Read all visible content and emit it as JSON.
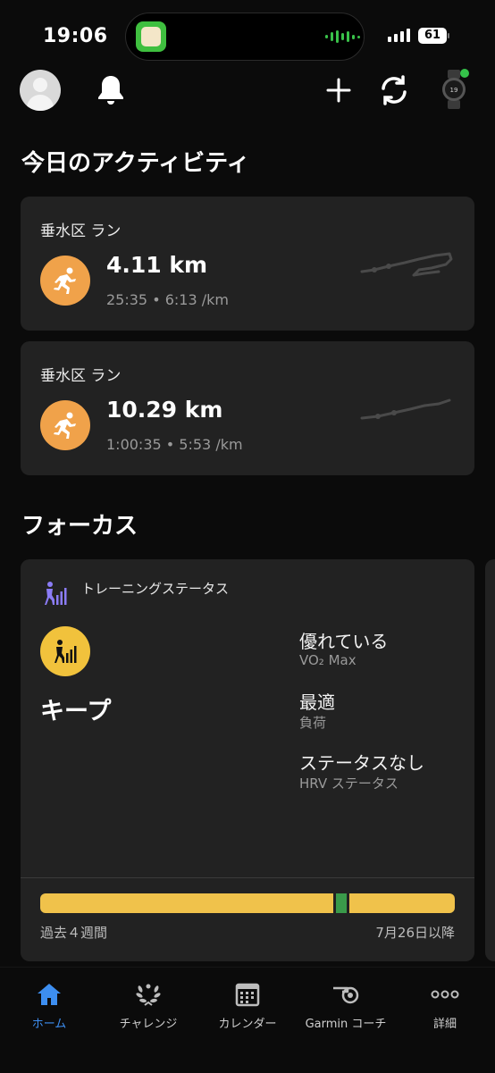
{
  "status_bar": {
    "time": "19:06",
    "battery": "61"
  },
  "today": {
    "title": "今日のアクティビティ",
    "activities": [
      {
        "name": "垂水区 ラン",
        "distance": "4.11 km",
        "duration": "25:35",
        "pace": "6:13 /km"
      },
      {
        "name": "垂水区 ラン",
        "distance": "10.29 km",
        "duration": "1:00:35",
        "pace": "5:53 /km"
      }
    ]
  },
  "focus": {
    "title": "フォーカス",
    "card_label": "トレーニングステータス",
    "status": "キープ",
    "stats": [
      {
        "value": "優れている",
        "label": "VO₂ Max"
      },
      {
        "value": "最適",
        "label": "負荷"
      },
      {
        "value": "ステータスなし",
        "label": "HRV ステータス"
      }
    ],
    "timeline": {
      "left": "過去４週間",
      "right": "7月26日以降"
    },
    "colors": {
      "bar": "#f0c24b",
      "current": "#3a9a4a"
    }
  },
  "tabs": [
    {
      "label": "ホーム",
      "icon": "home-icon",
      "active": true
    },
    {
      "label": "チャレンジ",
      "icon": "laurel-icon",
      "active": false
    },
    {
      "label": "カレンダー",
      "icon": "calendar-icon",
      "active": false
    },
    {
      "label": "Garmin コーチ",
      "icon": "whistle-icon",
      "active": false
    },
    {
      "label": "詳細",
      "icon": "more-icon",
      "active": false
    }
  ],
  "colors": {
    "accent": "#3d8ef0",
    "run": "#f0a24a",
    "status": "#f1c23c",
    "card": "#222222"
  }
}
